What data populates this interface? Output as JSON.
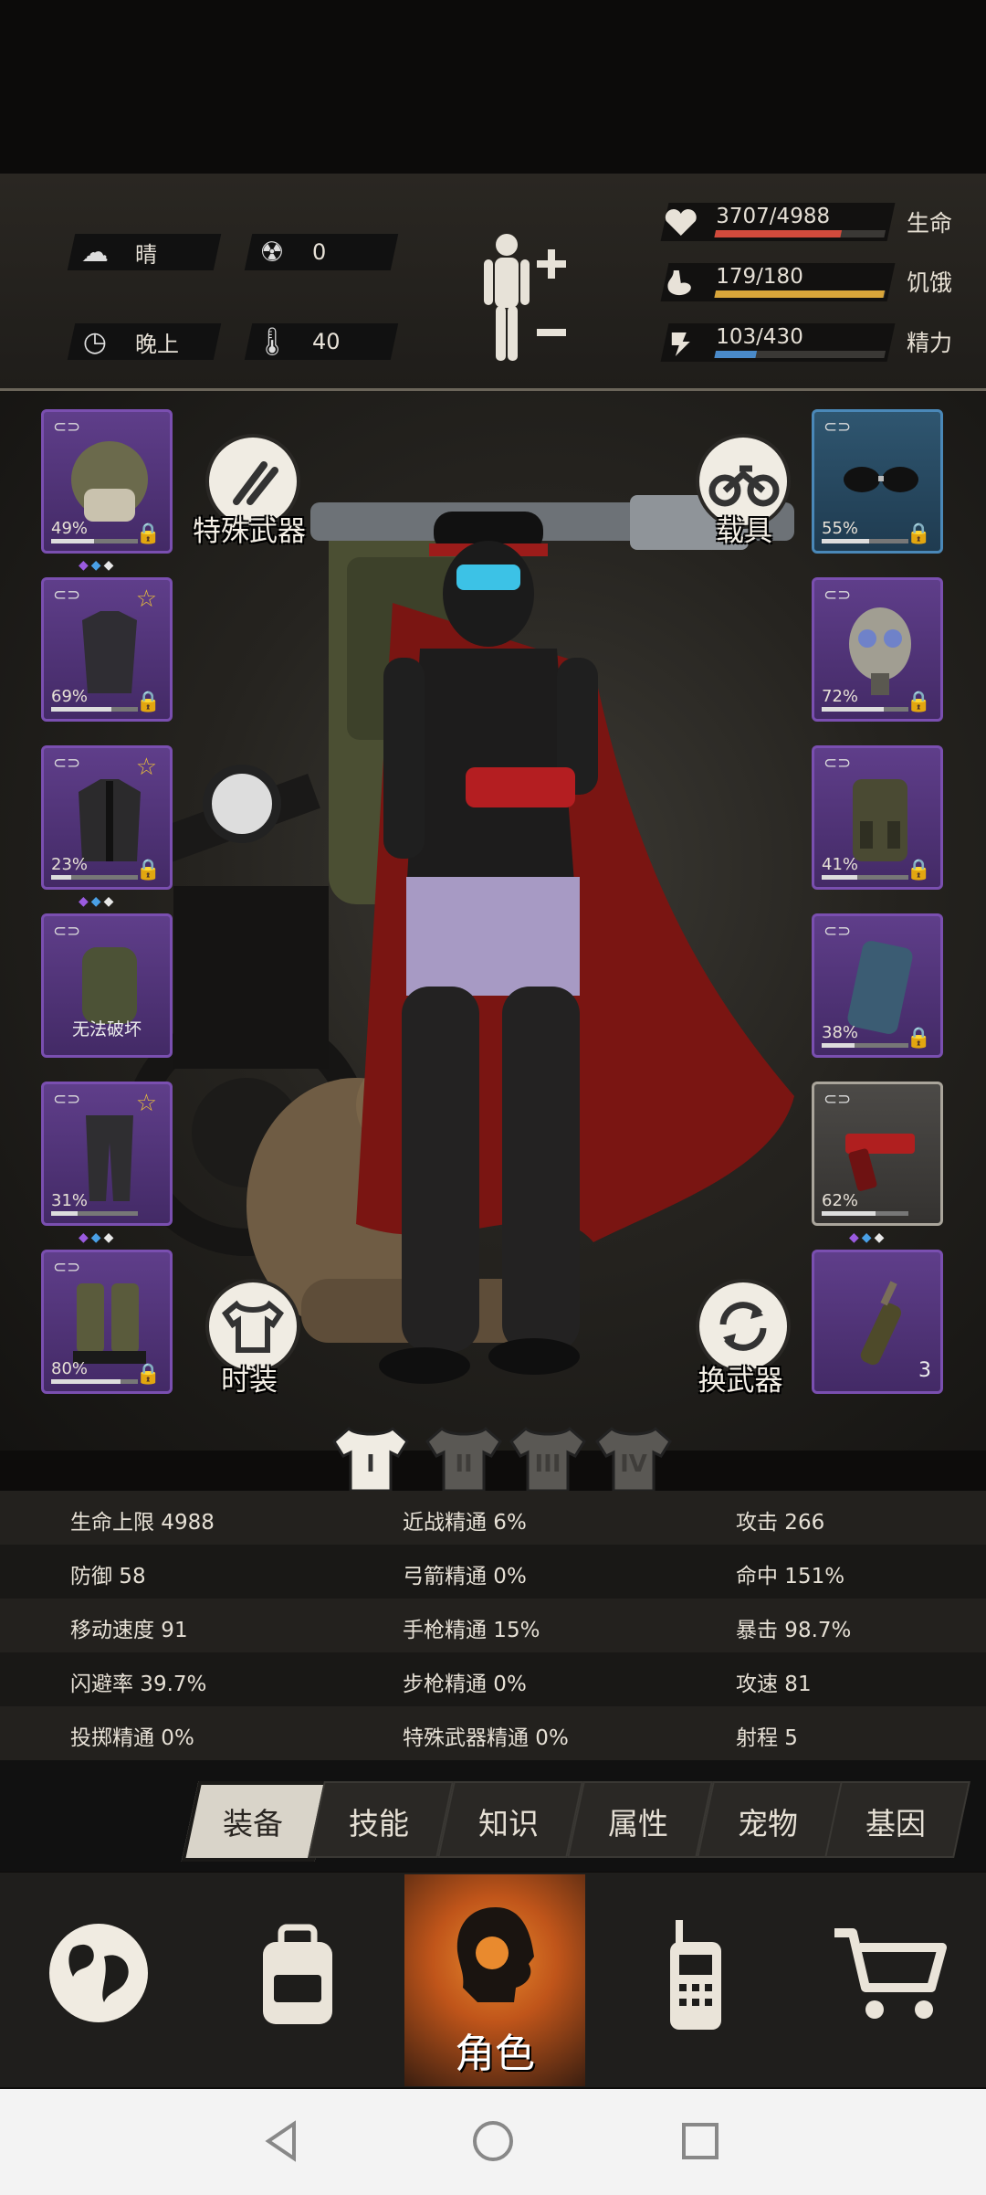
{
  "status": {
    "weather": "晴",
    "radiation": "0",
    "time_of_day": "晚上",
    "temperature": "40",
    "health": {
      "value": "3707/4988",
      "label": "生命",
      "fraction": 0.743,
      "color": "#d24b3c"
    },
    "hunger": {
      "value": "179/180",
      "label": "饥饿",
      "fraction": 0.994,
      "color": "#d8a53a"
    },
    "energy": {
      "value": "103/430",
      "label": "精力",
      "fraction": 0.24,
      "color": "#4a8ac9"
    }
  },
  "left_slots": [
    {
      "name": "helmet",
      "percent": "49%",
      "durability": 0.49,
      "locked": true,
      "gems": "◆◆◆"
    },
    {
      "name": "shirt",
      "percent": "69%",
      "durability": 0.69,
      "locked": true,
      "star": true
    },
    {
      "name": "jacket",
      "percent": "23%",
      "durability": 0.23,
      "locked": true,
      "star": true,
      "gems": "◆◆◆"
    },
    {
      "name": "backpack",
      "unbreakable": "无法破坏"
    },
    {
      "name": "pants",
      "percent": "31%",
      "durability": 0.31,
      "locked": false,
      "star": true,
      "gems": "◆◆◆"
    },
    {
      "name": "boots",
      "percent": "80%",
      "durability": 0.8,
      "locked": true
    }
  ],
  "right_slots": [
    {
      "name": "goggles",
      "percent": "55%",
      "durability": 0.55,
      "locked": true
    },
    {
      "name": "gas-mask",
      "percent": "72%",
      "durability": 0.72,
      "locked": true
    },
    {
      "name": "vest",
      "percent": "41%",
      "durability": 0.41,
      "locked": true
    },
    {
      "name": "shield",
      "percent": "38%",
      "durability": 0.38,
      "locked": true
    },
    {
      "name": "pistol",
      "percent": "62%",
      "durability": 0.62,
      "locked": false,
      "gems": "◆◆◆"
    },
    {
      "name": "molotov",
      "count": "3"
    }
  ],
  "buttons": {
    "special_weapon": "特殊武器",
    "vehicle": "载具",
    "costume": "时装",
    "swap_weapon": "换武器"
  },
  "loadouts": [
    "I",
    "II",
    "III",
    "IV"
  ],
  "stats_table": [
    [
      "生命上限 4988",
      "近战精通 6%",
      "攻击 266"
    ],
    [
      "防御 58",
      "弓箭精通 0%",
      "命中 151%"
    ],
    [
      "移动速度 91",
      "手枪精通 15%",
      "暴击 98.7%"
    ],
    [
      "闪避率 39.7%",
      "步枪精通 0%",
      "攻速 81"
    ],
    [
      "投掷精通 0%",
      "特殊武器精通 0%",
      "射程 5"
    ]
  ],
  "tabs": [
    {
      "label": "装备",
      "active": true
    },
    {
      "label": "技能"
    },
    {
      "label": "知识"
    },
    {
      "label": "属性"
    },
    {
      "label": "宠物"
    },
    {
      "label": "基因"
    }
  ],
  "nav": {
    "items": [
      "map",
      "backpack",
      "character",
      "radio",
      "shop"
    ],
    "active_label": "角色"
  }
}
